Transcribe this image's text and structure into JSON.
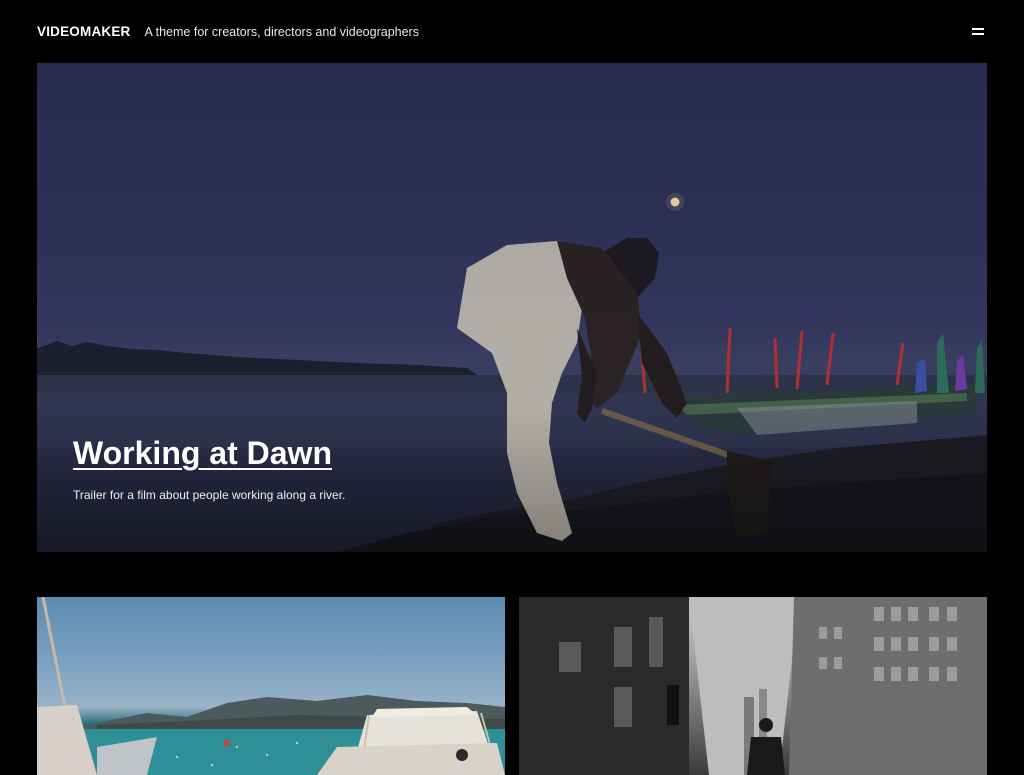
{
  "header": {
    "site_title": "VIDEOMAKER",
    "tagline": "A theme for creators, directors and videographers",
    "menu_icon": "hamburger-menu-icon"
  },
  "hero": {
    "title": "Working at Dawn",
    "description": "Trailer for a film about people working along a river."
  },
  "grid": {
    "cards": [
      {
        "image": "boat-on-sea-thumbnail"
      },
      {
        "image": "city-street-thumbnail"
      }
    ]
  },
  "colors": {
    "background": "#000000",
    "text": "#ffffff",
    "hero_sky": "#2e3258"
  }
}
